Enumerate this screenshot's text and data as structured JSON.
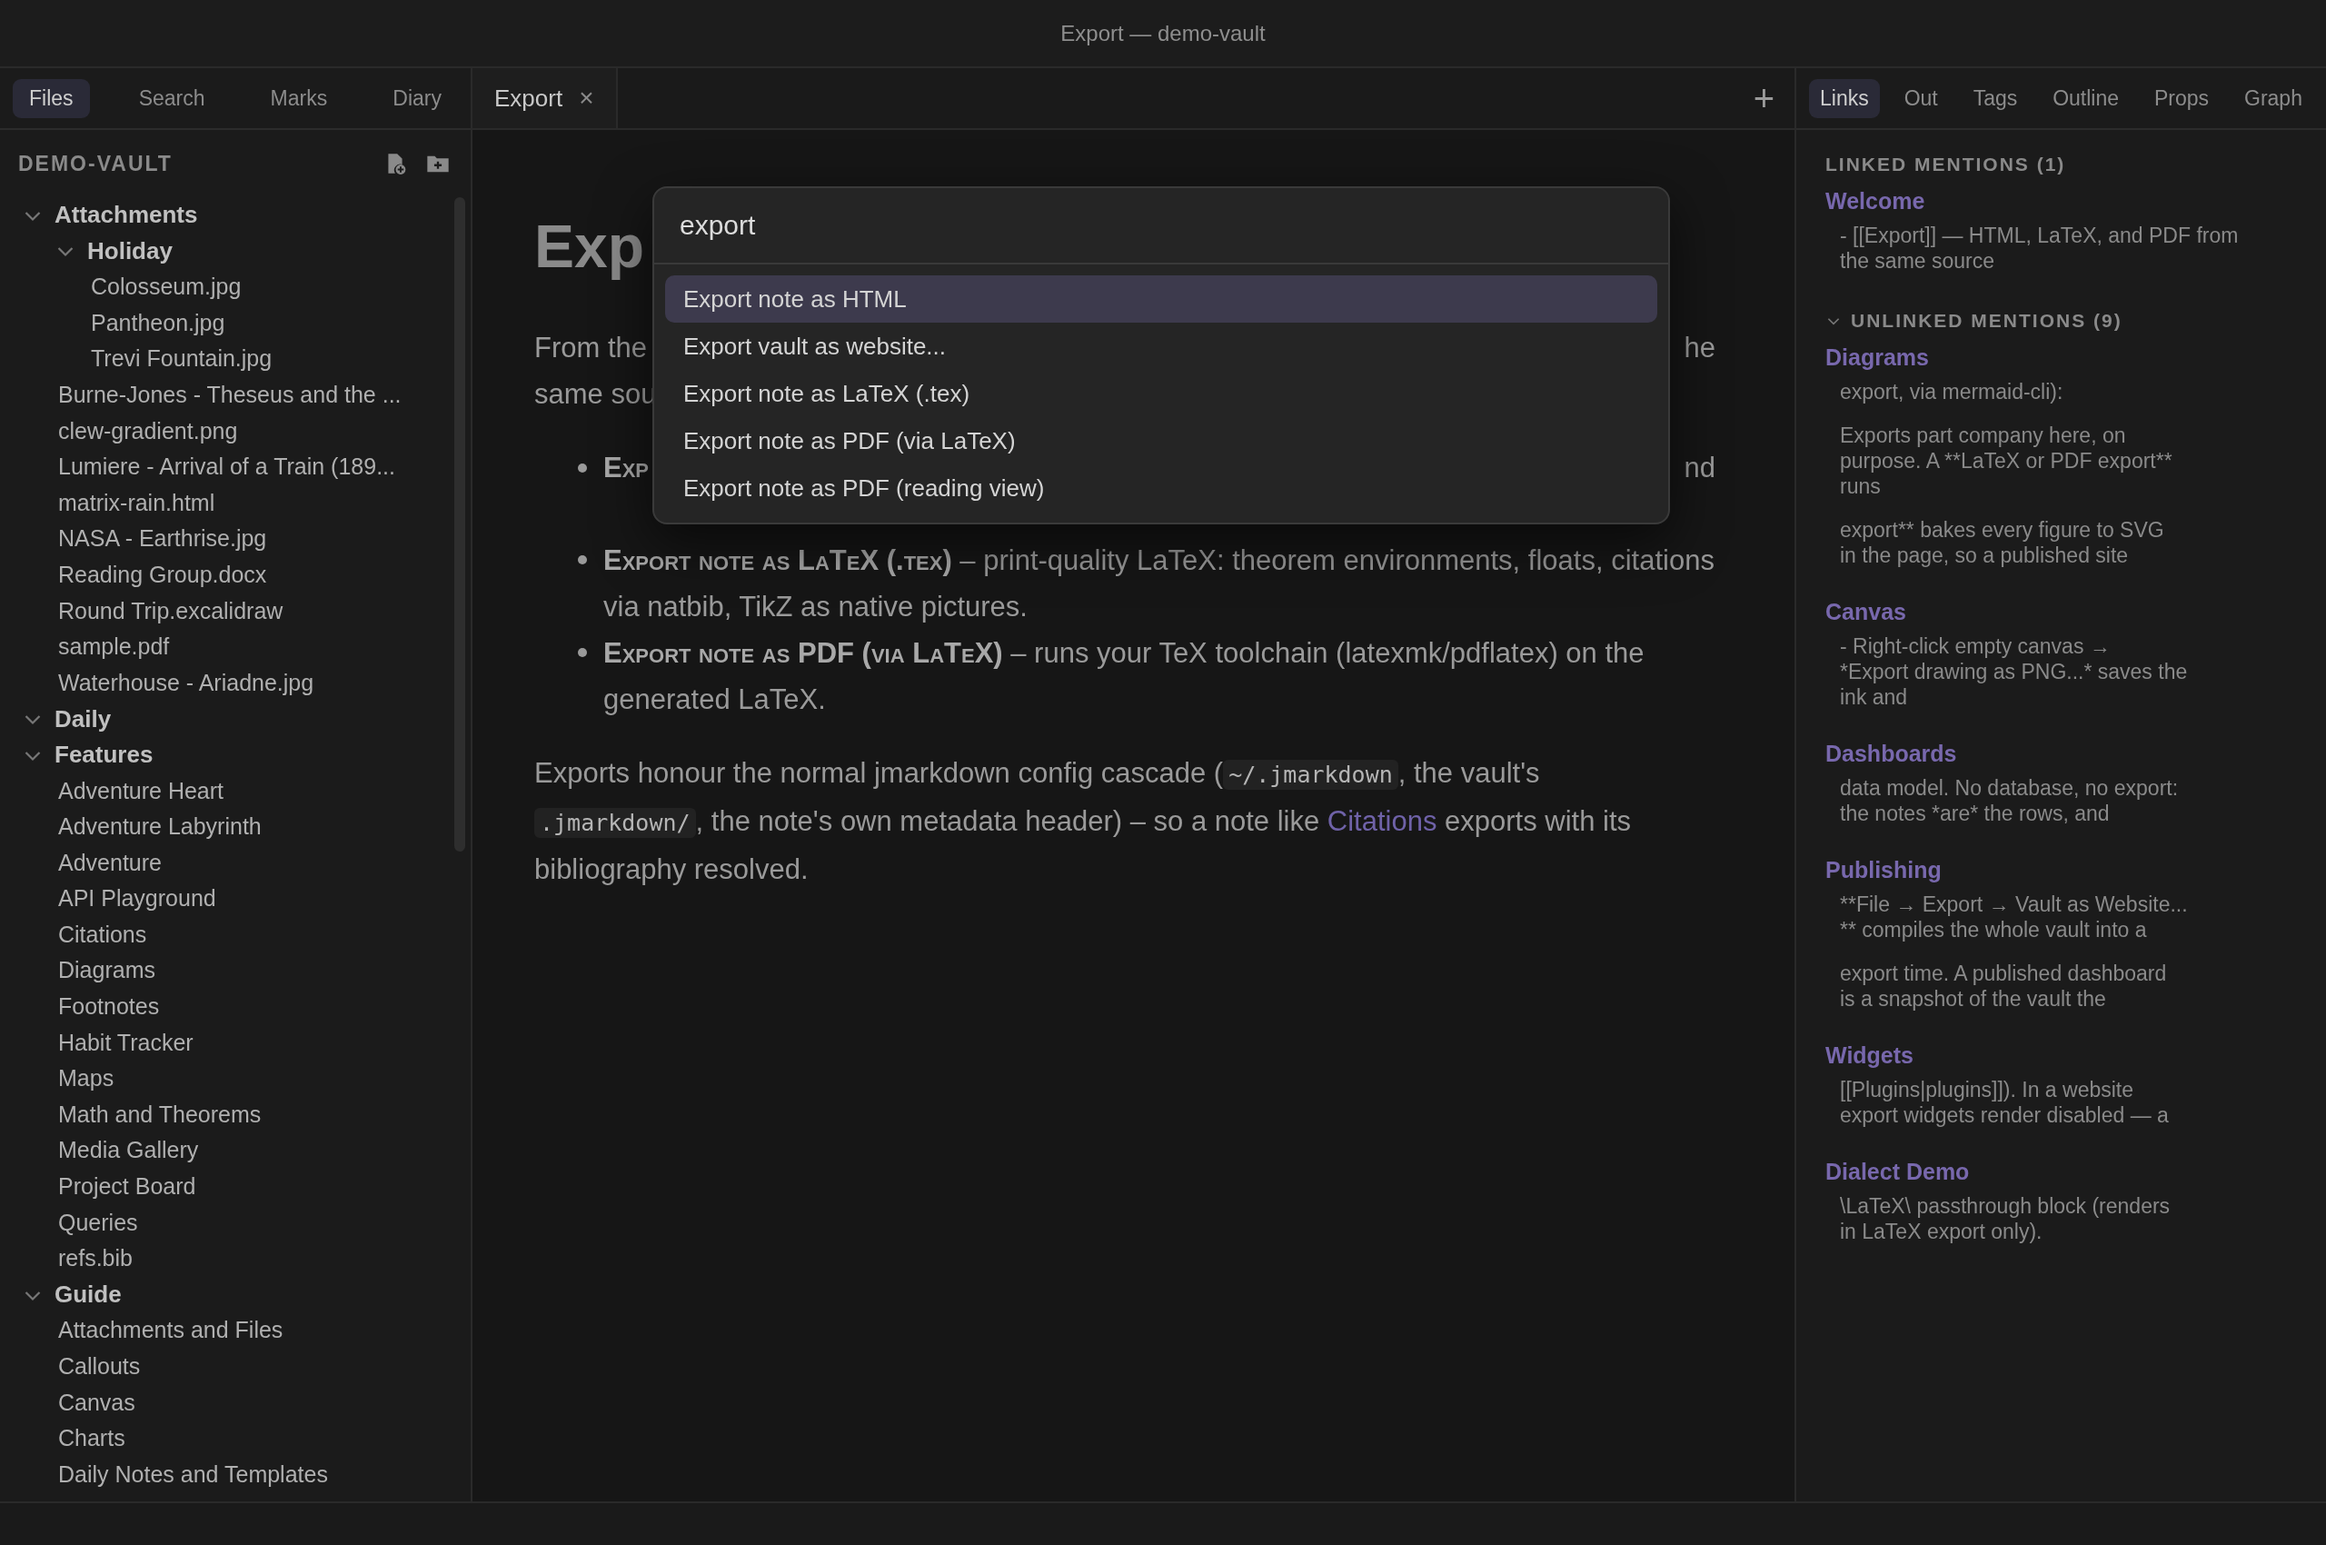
{
  "window": {
    "title": "Export — demo-vault"
  },
  "left_sidebar": {
    "tabs": [
      {
        "label": "Files",
        "selected": true
      },
      {
        "label": "Search",
        "selected": false
      },
      {
        "label": "Marks",
        "selected": false
      },
      {
        "label": "Diary",
        "selected": false
      }
    ],
    "vault_name": "DEMO-VAULT",
    "tree": [
      {
        "kind": "folder",
        "name": "Attachments",
        "expanded": true,
        "children": [
          {
            "kind": "folder",
            "name": "Holiday",
            "expanded": true,
            "children": [
              {
                "kind": "file",
                "name": "Colosseum.jpg"
              },
              {
                "kind": "file",
                "name": "Pantheon.jpg"
              },
              {
                "kind": "file",
                "name": "Trevi Fountain.jpg"
              }
            ]
          },
          {
            "kind": "file",
            "name": "Burne-Jones - Theseus and the ..."
          },
          {
            "kind": "file",
            "name": "clew-gradient.png"
          },
          {
            "kind": "file",
            "name": "Lumiere - Arrival of a Train (189..."
          },
          {
            "kind": "file",
            "name": "matrix-rain.html"
          },
          {
            "kind": "file",
            "name": "NASA - Earthrise.jpg"
          },
          {
            "kind": "file",
            "name": "Reading Group.docx"
          },
          {
            "kind": "file",
            "name": "Round Trip.excalidraw"
          },
          {
            "kind": "file",
            "name": "sample.pdf"
          },
          {
            "kind": "file",
            "name": "Waterhouse - Ariadne.jpg"
          }
        ]
      },
      {
        "kind": "folder",
        "name": "Daily",
        "expanded": true
      },
      {
        "kind": "folder",
        "name": "Features",
        "expanded": true,
        "children": [
          {
            "kind": "file",
            "name": "Adventure Heart"
          },
          {
            "kind": "file",
            "name": "Adventure Labyrinth"
          },
          {
            "kind": "file",
            "name": "Adventure"
          },
          {
            "kind": "file",
            "name": "API Playground"
          },
          {
            "kind": "file",
            "name": "Citations"
          },
          {
            "kind": "file",
            "name": "Diagrams"
          },
          {
            "kind": "file",
            "name": "Footnotes"
          },
          {
            "kind": "file",
            "name": "Habit Tracker"
          },
          {
            "kind": "file",
            "name": "Maps"
          },
          {
            "kind": "file",
            "name": "Math and Theorems"
          },
          {
            "kind": "file",
            "name": "Media Gallery"
          },
          {
            "kind": "file",
            "name": "Project Board"
          },
          {
            "kind": "file",
            "name": "Queries"
          },
          {
            "kind": "file",
            "name": "refs.bib"
          }
        ]
      },
      {
        "kind": "folder",
        "name": "Guide",
        "expanded": true,
        "children": [
          {
            "kind": "file",
            "name": "Attachments and Files"
          },
          {
            "kind": "file",
            "name": "Callouts"
          },
          {
            "kind": "file",
            "name": "Canvas"
          },
          {
            "kind": "file",
            "name": "Charts"
          },
          {
            "kind": "file",
            "name": "Daily Notes and Templates"
          }
        ]
      }
    ]
  },
  "editor": {
    "tabs": [
      {
        "label": "Export",
        "selected": true,
        "close": "×"
      }
    ],
    "new_tab": "+",
    "heading": "Exp",
    "covered_lines": [
      {
        "kind": "paragraph",
        "left": "From the",
        "right": "he"
      },
      {
        "kind": "paragraph",
        "left": "same sou"
      },
      {
        "kind": "bullet",
        "left": "Exp",
        "right": "nd"
      }
    ],
    "bullets": [
      "**Export note as LaTeX (.tex)** – print-quality LaTeX: theorem environments, floats, citations via natbib, TikZ as native pictures.",
      "**Export note as PDF (via LaTeX)** – runs your TeX toolchain (latexmk/pdflatex) on the generated LaTeX."
    ],
    "closing_paragraph": [
      {
        "kind": "text",
        "text": "Exports honour the normal jmarkdown config cascade ("
      },
      {
        "kind": "code",
        "text": "~/.jmarkdown"
      },
      {
        "kind": "text",
        "text": ", the vault's "
      },
      {
        "kind": "code",
        "text": ".jmarkdown/"
      },
      {
        "kind": "text",
        "text": ", the note's own metadata header) – so a note like "
      },
      {
        "kind": "link",
        "text": "Citations"
      },
      {
        "kind": "text",
        "text": " exports with its bibliography resolved."
      }
    ]
  },
  "command_palette": {
    "query": "export",
    "results": [
      {
        "label": "Export note as HTML",
        "selected": true
      },
      {
        "label": "Export vault as website...",
        "selected": false
      },
      {
        "label": "Export note as LaTeX (.tex)",
        "selected": false
      },
      {
        "label": "Export note as PDF (via LaTeX)",
        "selected": false
      },
      {
        "label": "Export note as PDF (reading view)",
        "selected": false
      }
    ]
  },
  "right_sidebar": {
    "tabs": [
      {
        "label": "Links",
        "selected": true
      },
      {
        "label": "Out",
        "selected": false
      },
      {
        "label": "Tags",
        "selected": false
      },
      {
        "label": "Outline",
        "selected": false
      },
      {
        "label": "Props",
        "selected": false
      },
      {
        "label": "Graph",
        "selected": false
      }
    ],
    "sections": [
      {
        "kind": "linked",
        "title": "LINKED MENTIONS (1)",
        "notes": [
          {
            "title": "Welcome",
            "snippets": [
              "- [[Export]] — HTML, LaTeX, and PDF from\nthe same source"
            ]
          }
        ]
      },
      {
        "kind": "unlinked",
        "title": "UNLINKED MENTIONS (9)",
        "expanded": true,
        "notes": [
          {
            "title": "Diagrams",
            "snippets": [
              "export, via mermaid-cli):",
              "Exports part company here, on\npurpose. A **LaTeX or PDF export**\nruns",
              "export** bakes every figure to SVG\nin the page, so a published site"
            ]
          },
          {
            "title": "Canvas",
            "snippets": [
              "- Right-click empty canvas →\n*Export drawing as PNG...* saves the\nink and"
            ]
          },
          {
            "title": "Dashboards",
            "snippets": [
              "data model. No database, no export:\nthe notes *are* the rows, and"
            ]
          },
          {
            "title": "Publishing",
            "snippets": [
              "**File → Export → Vault as Website...\n** compiles the whole vault into a",
              "export time. A published dashboard\nis a snapshot of the vault the"
            ]
          },
          {
            "title": "Widgets",
            "snippets": [
              "[[Plugins|plugins]]). In a website\nexport widgets render disabled — a"
            ]
          },
          {
            "title": "Dialect Demo",
            "snippets": [
              "\\LaTeX\\ passthrough block (renders\nin LaTeX export only)."
            ]
          }
        ]
      }
    ]
  }
}
